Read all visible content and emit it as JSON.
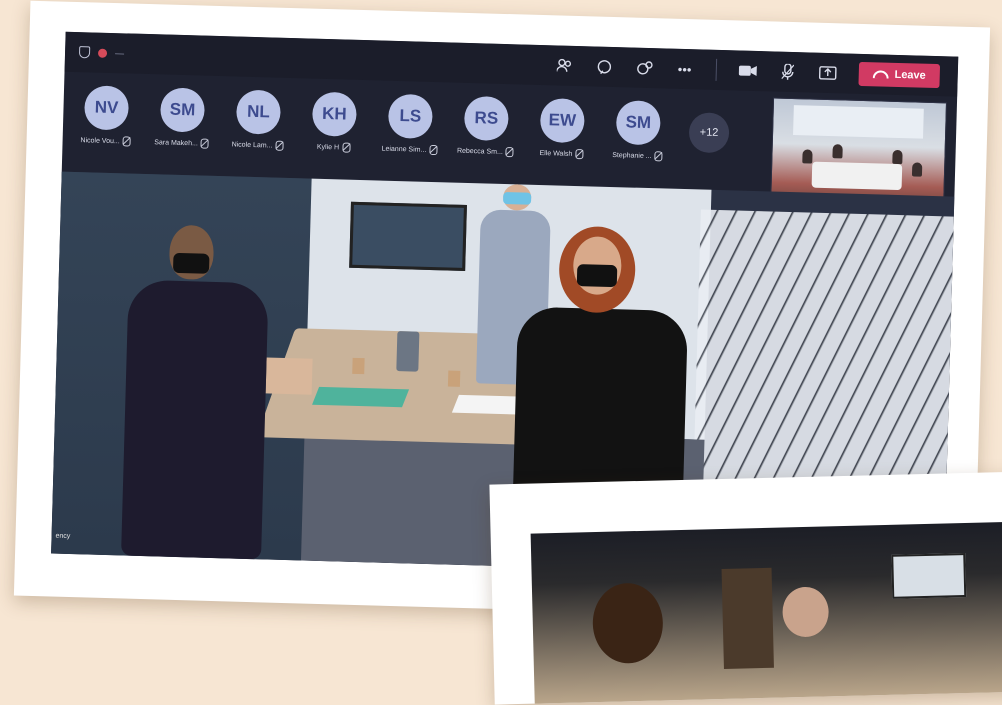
{
  "meeting": {
    "timer": "—",
    "toolbar": {
      "icons": [
        "people-icon",
        "chat-icon",
        "reactions-icon",
        "more-icon"
      ],
      "more_label": "•••",
      "camera_icon": "camera-icon",
      "mic_icon": "mic-icon",
      "share_icon": "share-icon",
      "leave_label": "Leave"
    },
    "participants": [
      {
        "initials": "NV",
        "name": "Nicole Vou..."
      },
      {
        "initials": "SM",
        "name": "Sara Makeh..."
      },
      {
        "initials": "NL",
        "name": "Nicole Lam..."
      },
      {
        "initials": "KH",
        "name": "Kylie H"
      },
      {
        "initials": "LS",
        "name": "Leianne Sim..."
      },
      {
        "initials": "RS",
        "name": "Rebecca Sm..."
      },
      {
        "initials": "EW",
        "name": "Elle Walsh"
      },
      {
        "initials": "SM",
        "name": "Stephanie ..."
      }
    ],
    "overflow_count": "+12",
    "main_video_label": "ency",
    "colors": {
      "leave": "#d13a63",
      "avatar_bg": "#b9c3e6",
      "avatar_text": "#3d4b8f",
      "bar_bg": "#1b1d2a"
    }
  }
}
